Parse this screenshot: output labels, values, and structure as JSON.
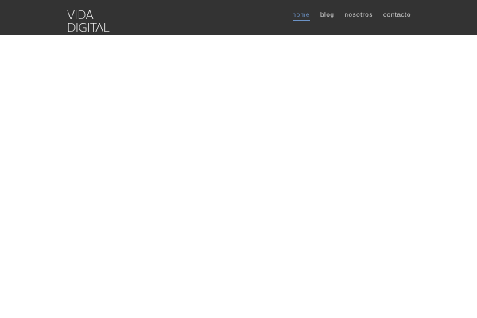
{
  "header": {
    "logo_line1": "VIDA",
    "logo_line2": "DIGITAL",
    "nav": [
      {
        "label": "home",
        "active": true
      },
      {
        "label": "blog",
        "active": false
      },
      {
        "label": "nosotros",
        "active": false
      },
      {
        "label": "contacto",
        "active": false
      }
    ]
  },
  "colors": {
    "header_bg": "#333333",
    "active_link": "#6c93c7",
    "background": "#ffffff"
  }
}
